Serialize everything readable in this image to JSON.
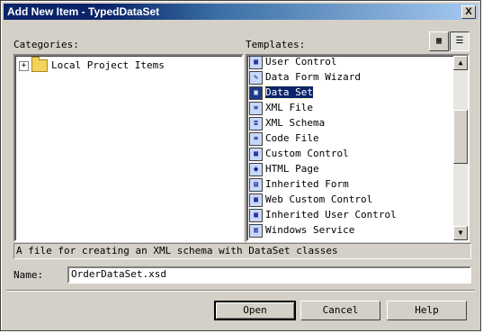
{
  "window": {
    "title": "Add New Item - TypedDataSet",
    "close_label": "X"
  },
  "categories": {
    "label": "Categories:",
    "tree_root": {
      "expander": "+",
      "label": "Local Project Items"
    }
  },
  "templates": {
    "label": "Templates:",
    "view_large_icon": "large-icons-view-icon",
    "view_list_icon": "list-view-icon",
    "items": [
      {
        "label": "User Control",
        "icon": "user-control-icon",
        "glyph": "▦"
      },
      {
        "label": "Data Form Wizard",
        "icon": "wizard-icon",
        "glyph": "✎"
      },
      {
        "label": "Data Set",
        "icon": "dataset-icon",
        "glyph": "▣",
        "selected": true
      },
      {
        "label": "XML File",
        "icon": "xml-file-icon",
        "glyph": "≡"
      },
      {
        "label": "XML Schema",
        "icon": "xml-schema-icon",
        "glyph": "≣"
      },
      {
        "label": "Code File",
        "icon": "code-file-icon",
        "glyph": "≡"
      },
      {
        "label": "Custom Control",
        "icon": "custom-control-icon",
        "glyph": "▦"
      },
      {
        "label": "HTML Page",
        "icon": "html-page-icon",
        "glyph": "◉"
      },
      {
        "label": "Inherited Form",
        "icon": "inherited-form-icon",
        "glyph": "▤"
      },
      {
        "label": "Web Custom Control",
        "icon": "web-custom-control-icon",
        "glyph": "▦"
      },
      {
        "label": "Inherited User Control",
        "icon": "inherited-user-control-icon",
        "glyph": "▦"
      },
      {
        "label": "Windows Service",
        "icon": "windows-service-icon",
        "glyph": "▥"
      }
    ]
  },
  "description": "A file for creating an XML schema with DataSet classes",
  "name_field": {
    "label": "Name:",
    "value": "OrderDataSet.xsd"
  },
  "buttons": {
    "open": "Open",
    "cancel": "Cancel",
    "help": "Help"
  }
}
